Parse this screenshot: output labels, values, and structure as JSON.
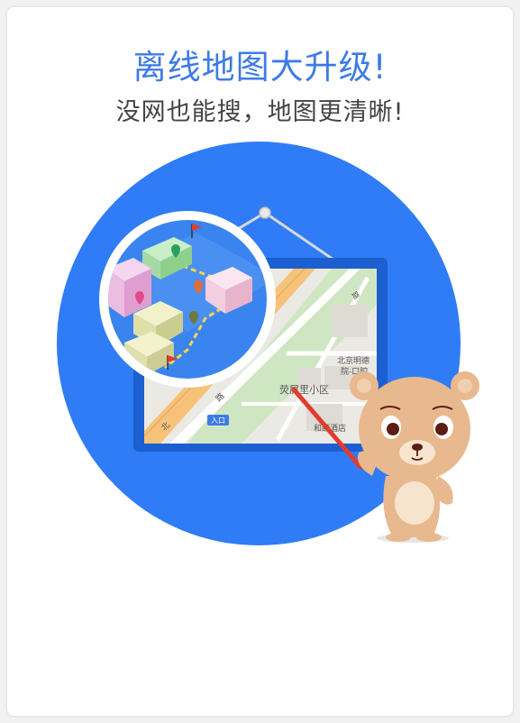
{
  "header": {
    "title": "离线地图大升级!",
    "subtitle": "没网也能搜，地图更清晰!"
  },
  "map_labels": {
    "poi_name": "北京明德",
    "poi_name_2": "院-口腔",
    "community": "荧屏里小区",
    "hotel": "和颐酒店",
    "entrance": "入口",
    "road_1": "北",
    "road_2": "路",
    "road_3": "路"
  },
  "colors": {
    "accent": "#3d7be6",
    "circle_blue": "#2f7cf6",
    "bear_body": "#e8b98e",
    "pointer_red": "#e23b2e"
  }
}
